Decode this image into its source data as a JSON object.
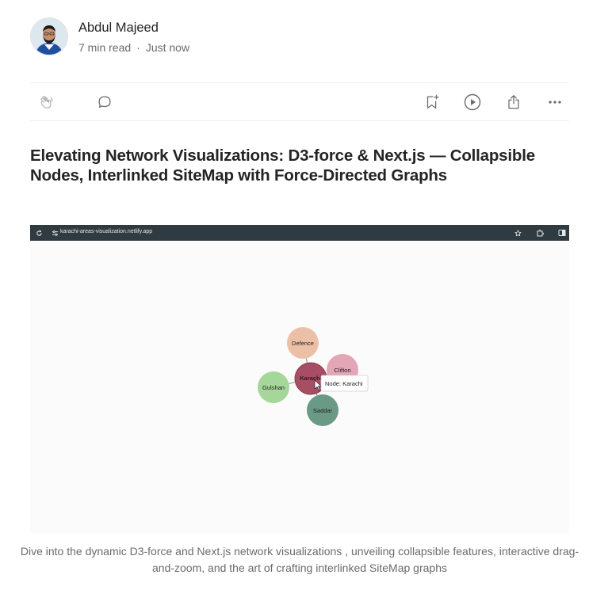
{
  "author": {
    "name": "Abdul Majeed",
    "read_time": "7 min read",
    "separator": "·",
    "published": "Just now"
  },
  "actions": {
    "clap_icon": "clap-icon",
    "comment_icon": "comment-icon",
    "save_icon": "bookmark-add-icon",
    "listen_icon": "play-icon",
    "share_icon": "share-icon",
    "more_icon": "more-icon"
  },
  "article": {
    "title": "Elevating Network Visualizations: D3-force & Next.js — Collapsible Nodes, Interlinked SiteMap with Force-Directed Graphs",
    "caption": "Dive into the dynamic D3-force and Next.js network visualizations , unveiling collapsible features, interactive drag-and-zoom, and the art of crafting interlinked SiteMap graphs"
  },
  "screenshot": {
    "url": "karachi-areas-visualization.netlify.app",
    "nodes": [
      {
        "label": "Defence",
        "color": "#ecc0a6"
      },
      {
        "label": "Clifton",
        "color": "#e3a6b6"
      },
      {
        "label": "Karachi",
        "color": "#a84e64"
      },
      {
        "label": "Gulshan",
        "color": "#a6d79a"
      },
      {
        "label": "Saddar",
        "color": "#6a9a86"
      }
    ],
    "tooltip": "Node: Karachi"
  },
  "colors": {
    "text": "#242424",
    "muted": "#6b6b6b",
    "browser_bar": "#2f3b40"
  }
}
